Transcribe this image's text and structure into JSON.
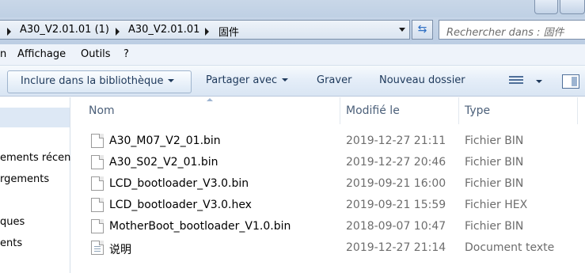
{
  "address": {
    "crumbs": [
      "A30_V2.01.01 (1)",
      "A30_V2.01.01",
      "固件"
    ],
    "search_placeholder": "Rechercher dans : 固件"
  },
  "menu": {
    "items": [
      "n",
      "Affichage",
      "Outils",
      "?"
    ]
  },
  "commands": {
    "include": "Inclure dans la bibliothèque",
    "share": "Partager avec",
    "burn": "Graver",
    "new_folder": "Nouveau dossier"
  },
  "navigation": {
    "items": [
      "ements récen",
      "rgements",
      "ques",
      "ents"
    ]
  },
  "columns": {
    "name": "Nom",
    "modified": "Modifié le",
    "type": "Type"
  },
  "files": [
    {
      "name": "A30_M07_V2_01.bin",
      "modified": "2019-12-27 21:11",
      "type": "Fichier BIN",
      "icon": "generic-file-icon"
    },
    {
      "name": "A30_S02_V2_01.bin",
      "modified": "2019-12-27 20:46",
      "type": "Fichier BIN",
      "icon": "generic-file-icon"
    },
    {
      "name": "LCD_bootloader_V3.0.bin",
      "modified": "2019-09-21 16:00",
      "type": "Fichier BIN",
      "icon": "generic-file-icon"
    },
    {
      "name": "LCD_bootloader_V3.0.hex",
      "modified": "2019-09-21 15:59",
      "type": "Fichier HEX",
      "icon": "generic-file-icon"
    },
    {
      "name": "MotherBoot_bootloader_V1.0.bin",
      "modified": "2018-09-07 10:47",
      "type": "Fichier BIN",
      "icon": "generic-file-icon"
    },
    {
      "name": "说明",
      "modified": "2019-12-27 21:14",
      "type": "Document texte",
      "icon": "text-document-icon"
    }
  ]
}
